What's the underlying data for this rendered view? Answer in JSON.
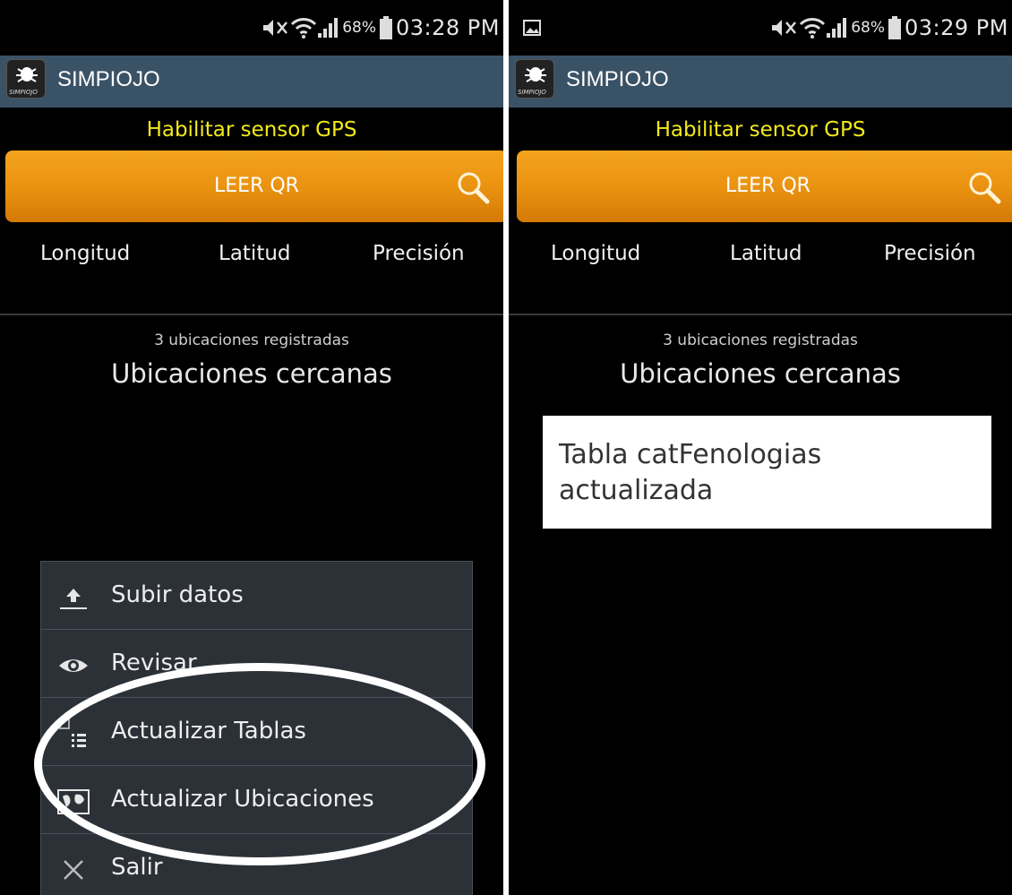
{
  "left": {
    "status": {
      "battery": "68%",
      "time": "03:28 PM"
    },
    "app_title": "SIMPIOJO",
    "app_icon_label": "SIMPIOJO",
    "gps_link": "Habilitar sensor GPS",
    "qr_button": "LEER QR",
    "coords": {
      "longitud": "Longitud",
      "latitud": "Latitud",
      "precision": "Precisión"
    },
    "count": "3 ubicaciones registradas",
    "nearby": "Ubicaciones cercanas",
    "menu": [
      {
        "label": "Subir datos",
        "icon": "upload-icon"
      },
      {
        "label": "Revisar",
        "icon": "eye-icon"
      },
      {
        "label": "Actualizar Tablas",
        "icon": "table-list-icon"
      },
      {
        "label": "Actualizar Ubicaciones",
        "icon": "map-icon"
      },
      {
        "label": "Salir",
        "icon": "close-icon"
      }
    ]
  },
  "right": {
    "status": {
      "battery": "68%",
      "time": "03:29 PM"
    },
    "app_title": "SIMPIOJO",
    "app_icon_label": "SIMPIOJO",
    "gps_link": "Habilitar sensor GPS",
    "qr_button": "LEER QR",
    "coords": {
      "longitud": "Longitud",
      "latitud": "Latitud",
      "precision": "Precisión"
    },
    "count": "3 ubicaciones registradas",
    "nearby": "Ubicaciones cercanas",
    "toast": {
      "line1": "Tabla catFenologias",
      "line2": "actualizada"
    }
  },
  "colors": {
    "appbar": "#3a5266",
    "gps_link": "#f2ea1a",
    "qr_button": "#ea9311",
    "menu_bg": "#2c3138",
    "highlight": "#ffffff"
  }
}
